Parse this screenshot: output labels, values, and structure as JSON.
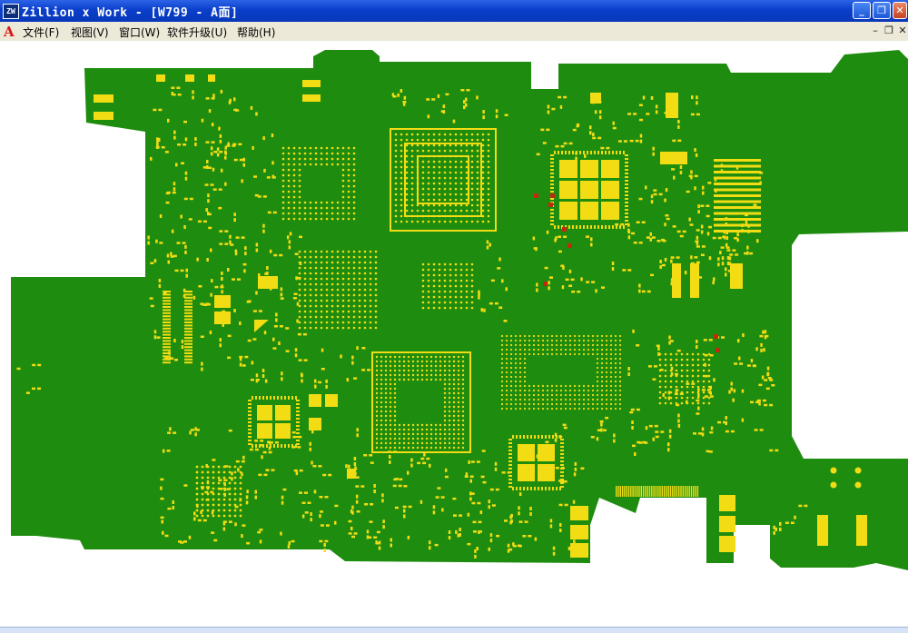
{
  "window": {
    "app_icon_text": "ZW",
    "title": "Zillion x Work - [W799 - A面]",
    "minimize_glyph": "_",
    "restore_glyph": "❐",
    "close_glyph": "✕"
  },
  "menubar": {
    "doc_icon_text": "A",
    "items": [
      "文件(F)",
      "视图(V)",
      "窗口(W)",
      "软件升级(U)",
      "帮助(H)"
    ],
    "mdi_minimize": "–",
    "mdi_restore": "❐",
    "mdi_close": "✕"
  },
  "board": {
    "board_color": "#1e8c0e",
    "pad_color": "#f2dc14",
    "marker_color": "#c22a10",
    "chips": [
      {
        "type": "bga",
        "name": "bga-chip-cpu"
      },
      {
        "type": "bga",
        "name": "bga-chip-memory"
      },
      {
        "type": "bga",
        "name": "bga-chip-pmic"
      },
      {
        "type": "bga",
        "name": "bga-chip-baseband"
      },
      {
        "type": "bga",
        "name": "bga-chip-rf"
      },
      {
        "type": "bga",
        "name": "bga-chip-center"
      },
      {
        "type": "qfn",
        "name": "qfn-chip-lower"
      },
      {
        "type": "qfn",
        "name": "qfn-chip-upper-right"
      },
      {
        "type": "qfn",
        "name": "qfn-chip-left"
      }
    ]
  }
}
